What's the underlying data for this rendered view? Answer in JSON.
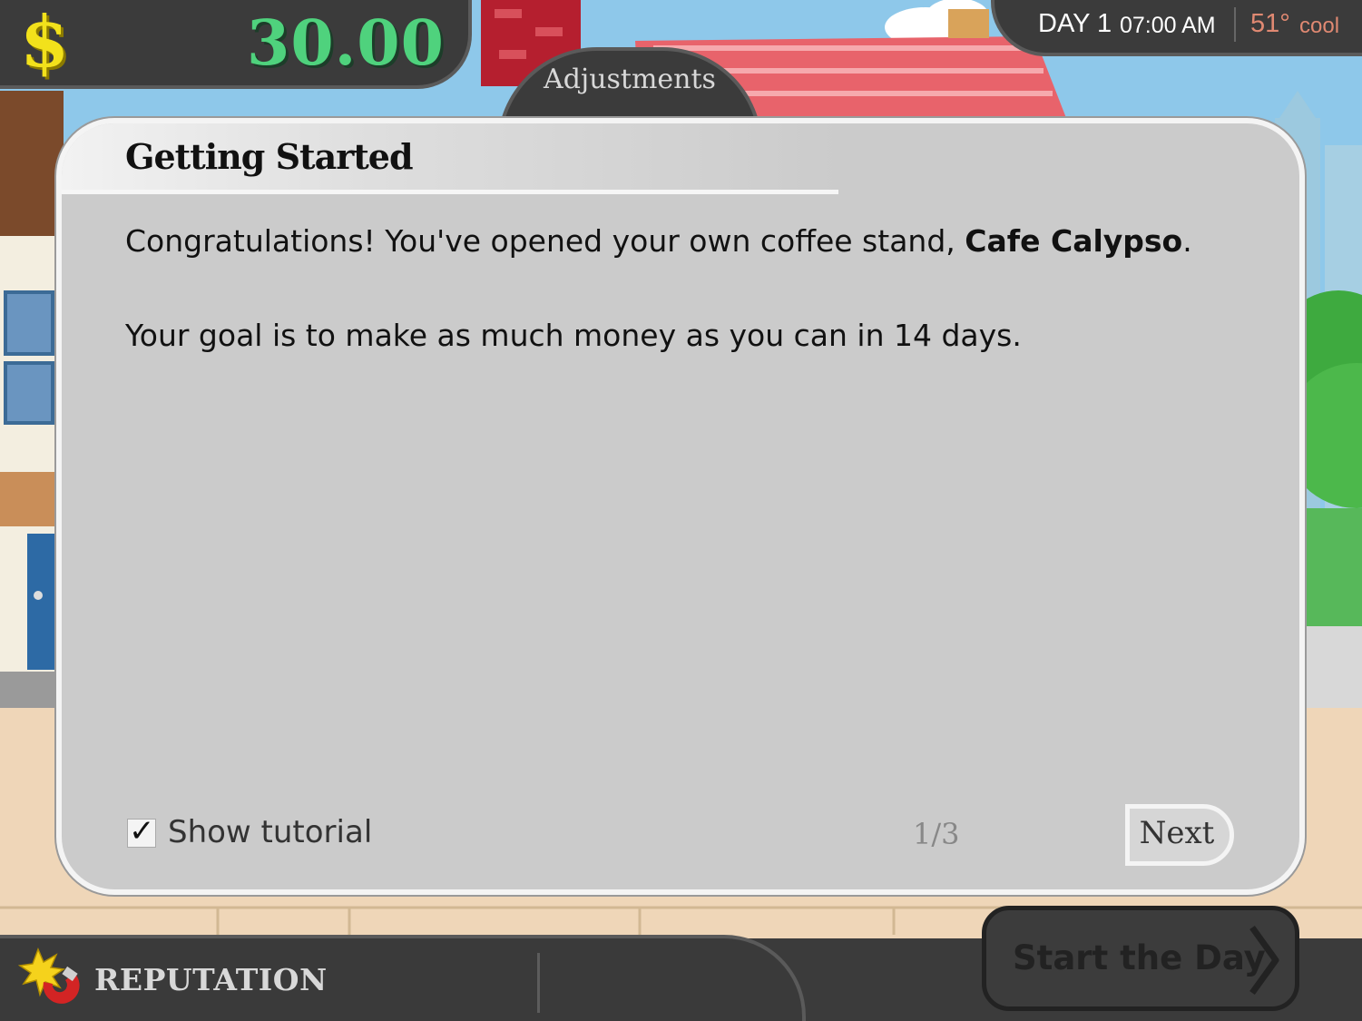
{
  "hud": {
    "money": "30.00",
    "adjustments_tab": "Adjustments",
    "day": "DAY 1",
    "time": "07:00 AM",
    "temperature": "51°",
    "weather": "cool"
  },
  "dialog": {
    "title": "Getting Started",
    "line1_before": "Congratulations! You've opened your own coffee stand, ",
    "cafe_name": "Cafe Calypso",
    "line1_after": ".",
    "line2": "Your goal is to make as much money as you can in 14 days.",
    "show_tutorial_label": "Show tutorial",
    "show_tutorial_checked": true,
    "page_counter": "1/3",
    "next_label": "Next"
  },
  "footer": {
    "reputation_label": "REPUTATION",
    "start_button_label": "Start the Day"
  },
  "colors": {
    "money_green": "#4fd27d",
    "dollar_yellow": "#f2e11b",
    "temperature_salmon": "#e08972",
    "panel_dark": "#3b3b3b"
  },
  "icons": [
    "dollar-sign-icon",
    "check-mark-icon",
    "reputation-magnet-icon",
    "chevron-right-icon"
  ]
}
